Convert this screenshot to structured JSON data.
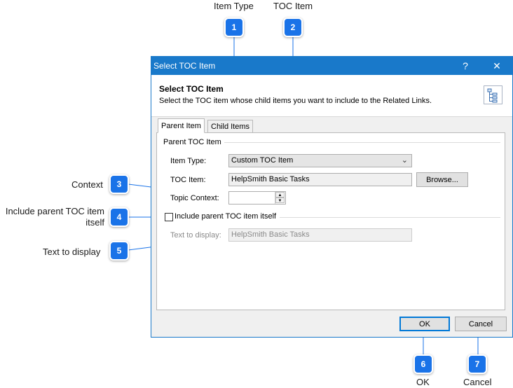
{
  "callouts": [
    {
      "number": "1",
      "label": "Item Type"
    },
    {
      "number": "2",
      "label": "TOC Item"
    },
    {
      "number": "3",
      "label": "Context"
    },
    {
      "number": "4",
      "label": "Include parent TOC item itself"
    },
    {
      "number": "5",
      "label": "Text to display"
    },
    {
      "number": "6",
      "label": "OK"
    },
    {
      "number": "7",
      "label": "Cancel"
    }
  ],
  "dialog": {
    "window_title": "Select TOC Item",
    "help_glyph": "?",
    "close_glyph": "✕",
    "header_title": "Select TOC Item",
    "header_description": "Select the TOC item whose child items you want to include to the Related Links.",
    "tabs": [
      {
        "label": "Parent Item",
        "active": true
      },
      {
        "label": "Child Items",
        "active": false
      }
    ],
    "parent_group_title": "Parent TOC Item",
    "item_type": {
      "label": "Item Type:",
      "value": "Custom TOC Item"
    },
    "toc_item": {
      "label": "TOC Item:",
      "value": "HelpSmith Basic Tasks",
      "browse_label": "Browse..."
    },
    "topic_context": {
      "label": "Topic Context:",
      "value": ""
    },
    "include_parent": {
      "label": "Include parent TOC item itself",
      "checked": false
    },
    "text_to_display": {
      "label": "Text to display:",
      "value": "HelpSmith Basic Tasks"
    },
    "ok_label": "OK",
    "cancel_label": "Cancel"
  },
  "colors": {
    "accent": "#1979ca",
    "badge": "#1a73e8"
  }
}
